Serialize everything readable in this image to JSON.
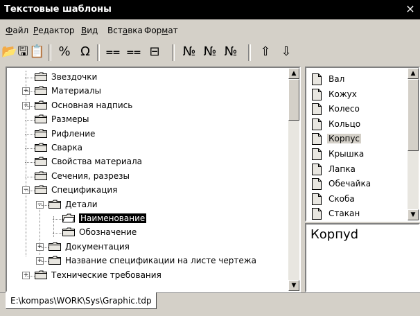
{
  "window": {
    "title": "Текстовые шаблоны",
    "close_glyph": "×"
  },
  "menu": [
    {
      "label": "Файл",
      "ul": "Ф",
      "rest": "айл"
    },
    {
      "label": "Редактор",
      "ul": "Р",
      "rest": "едактор"
    },
    {
      "label": "Вид",
      "ul": "В",
      "rest": "ид"
    },
    {
      "label": "Вставка",
      "pre": "Вст",
      "ul": "а",
      "rest": "вка"
    },
    {
      "label": "Формат",
      "pre": "Фор",
      "ul": "м",
      "rest": "ат"
    }
  ],
  "toolbar": {
    "buttons": [
      {
        "name": "open-icon",
        "glyph": "📂"
      },
      {
        "name": "save-icon",
        "glyph": "🖫"
      },
      {
        "name": "paste-icon",
        "glyph": "📋"
      },
      {
        "name": "percent-icon",
        "glyph": "%"
      },
      {
        "name": "omega-icon",
        "glyph": "Ω"
      },
      {
        "name": "insert-line-above-icon",
        "glyph": "⩵"
      },
      {
        "name": "insert-line-below-icon",
        "glyph": "⩵"
      },
      {
        "name": "insert-table-icon",
        "glyph": "⊟"
      },
      {
        "name": "numbered-line-icon",
        "glyph": "№"
      },
      {
        "name": "numbered-line-2-icon",
        "glyph": "№"
      },
      {
        "name": "numbered-table-icon",
        "glyph": "№"
      },
      {
        "name": "move-up-icon",
        "glyph": "⇧"
      },
      {
        "name": "move-down-icon",
        "glyph": "⇩"
      }
    ]
  },
  "tree": {
    "items": [
      {
        "label": "Звездочки",
        "level": 0,
        "expandable": false
      },
      {
        "label": "Материалы",
        "level": 0,
        "expandable": true,
        "state": "+"
      },
      {
        "label": "Основная надпись",
        "level": 0,
        "expandable": true,
        "state": "+"
      },
      {
        "label": "Размеры",
        "level": 0,
        "expandable": false
      },
      {
        "label": "Рифление",
        "level": 0,
        "expandable": false
      },
      {
        "label": "Сварка",
        "level": 0,
        "expandable": false
      },
      {
        "label": "Свойства материала",
        "level": 0,
        "expandable": false
      },
      {
        "label": "Сечения, разрезы",
        "level": 0,
        "expandable": false
      },
      {
        "label": "Спецификация",
        "level": 0,
        "expandable": true,
        "state": "−"
      },
      {
        "label": "Детали",
        "level": 1,
        "expandable": true,
        "state": "−"
      },
      {
        "label": "Наименование",
        "level": 2,
        "expandable": false,
        "selected": true
      },
      {
        "label": "Обозначение",
        "level": 2,
        "expandable": false
      },
      {
        "label": "Документация",
        "level": 1,
        "expandable": true,
        "state": "+"
      },
      {
        "label": "Название спецификации на листе чертежа",
        "level": 1,
        "expandable": true,
        "state": "+"
      },
      {
        "label": "Технические требования",
        "level": 0,
        "expandable": true,
        "state": "+"
      }
    ]
  },
  "list": {
    "items": [
      {
        "label": "Вал"
      },
      {
        "label": "Кожух"
      },
      {
        "label": "Колесо"
      },
      {
        "label": "Кольцо"
      },
      {
        "label": "Корпус",
        "selected": true
      },
      {
        "label": "Крышка"
      },
      {
        "label": "Лапка"
      },
      {
        "label": "Обечайка"
      },
      {
        "label": "Скоба"
      },
      {
        "label": "Стакан"
      }
    ]
  },
  "preview": {
    "text": "Корпуd"
  },
  "status": {
    "path": "E:\\kompas\\WORK\\Sys\\Graphic.tdp"
  },
  "scroll": {
    "up_glyph": "▲",
    "down_glyph": "▼"
  }
}
